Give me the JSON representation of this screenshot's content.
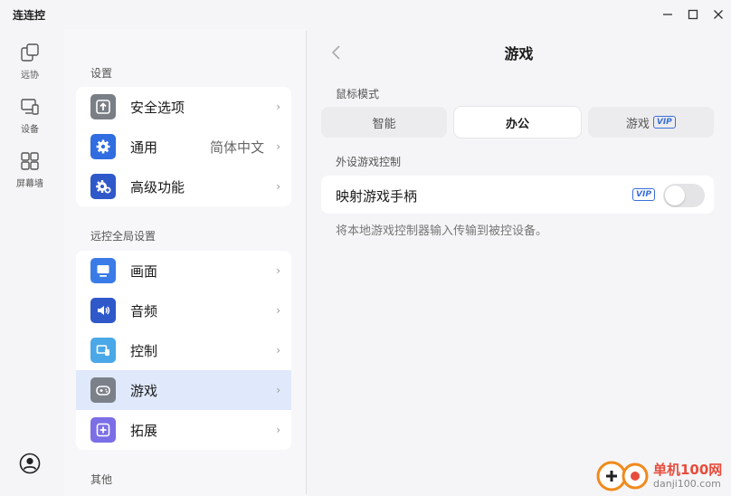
{
  "app": {
    "title": "连连控"
  },
  "window": {
    "minimize_icon": "minimize-icon",
    "maximize_icon": "maximize-icon",
    "close_icon": "close-icon"
  },
  "rail": {
    "items": [
      {
        "label": "远协",
        "icon": "remote-assist-icon"
      },
      {
        "label": "设备",
        "icon": "devices-icon"
      },
      {
        "label": "屏幕墙",
        "icon": "screen-wall-icon"
      }
    ],
    "avatar_icon": "user-avatar-icon"
  },
  "settings": {
    "section1": "设置",
    "group1": [
      {
        "label": "安全选项",
        "icon": "shield-upload-icon",
        "color": "#7a7f86"
      },
      {
        "label": "通用",
        "value": "简体中文",
        "icon": "gear-icon",
        "color": "#2f6de0"
      },
      {
        "label": "高级功能",
        "icon": "gear-plus-icon",
        "color": "#2f58c9"
      }
    ],
    "section2": "远控全局设置",
    "group2": [
      {
        "label": "画面",
        "icon": "monitor-icon",
        "color": "#3a7be8"
      },
      {
        "label": "音频",
        "icon": "speaker-icon",
        "color": "#2f58c9"
      },
      {
        "label": "控制",
        "icon": "control-icon",
        "color": "#4aa8e8"
      },
      {
        "label": "游戏",
        "icon": "gamepad-icon",
        "color": "#7c8088"
      },
      {
        "label": "拓展",
        "icon": "plus-square-icon",
        "color": "#7b6ee6"
      }
    ],
    "section3": "其他",
    "active": "游戏"
  },
  "content": {
    "title": "游戏",
    "mouse_mode_label": "鼠标模式",
    "mouse_modes": [
      {
        "label": "智能"
      },
      {
        "label": "办公"
      },
      {
        "label": "游戏",
        "badge": "VIP"
      }
    ],
    "mouse_mode_selected": "办公",
    "peripheral_label": "外设游戏控制",
    "map_gamepad": {
      "label": "映射游戏手柄",
      "badge": "VIP",
      "enabled": false,
      "description": "将本地游戏控制器输入传输到被控设备。"
    }
  },
  "watermark": {
    "text": "单机100网",
    "url": "danji100.com"
  },
  "colors": {
    "accent": "#3a6fd8",
    "active_row": "#dfe9fb",
    "watermark": "#e74c3c"
  }
}
